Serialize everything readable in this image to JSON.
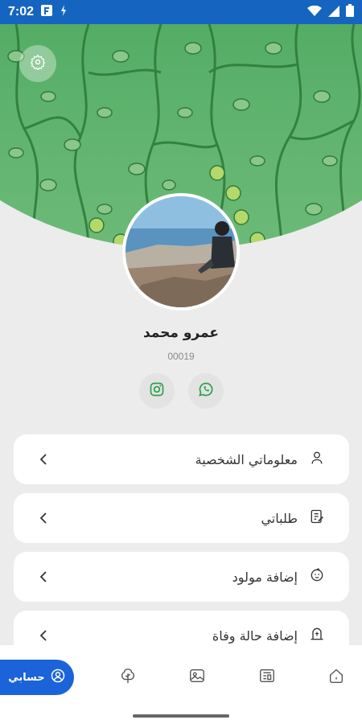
{
  "status_bar": {
    "time": "7:02",
    "left_icons": [
      "app-icon",
      "data-icon"
    ],
    "right_icons": [
      "wifi-icon",
      "signal-icon",
      "battery-icon"
    ],
    "color": "#1565c0"
  },
  "header": {
    "settings_icon": "gear-icon",
    "background_color": "#3b9c4e"
  },
  "profile": {
    "name": "عمرو محمد",
    "id": "00019",
    "avatar": "profile-photo"
  },
  "social": [
    {
      "icon": "whatsapp-icon"
    },
    {
      "icon": "instagram-icon"
    }
  ],
  "menu": {
    "items": [
      {
        "label": "معلوماتي الشخصية",
        "icon": "person-icon"
      },
      {
        "label": "طلباتي",
        "icon": "document-edit-icon"
      },
      {
        "label": "إضافة مولود",
        "icon": "baby-icon"
      },
      {
        "label": "إضافة حالة وفاة",
        "icon": "grave-icon"
      }
    ]
  },
  "bottom_nav": {
    "active_label": "حسابي",
    "active_color": "#1a63d9",
    "items": [
      "account-icon",
      "tree-icon",
      "gallery-icon",
      "news-icon",
      "home-icon"
    ]
  }
}
